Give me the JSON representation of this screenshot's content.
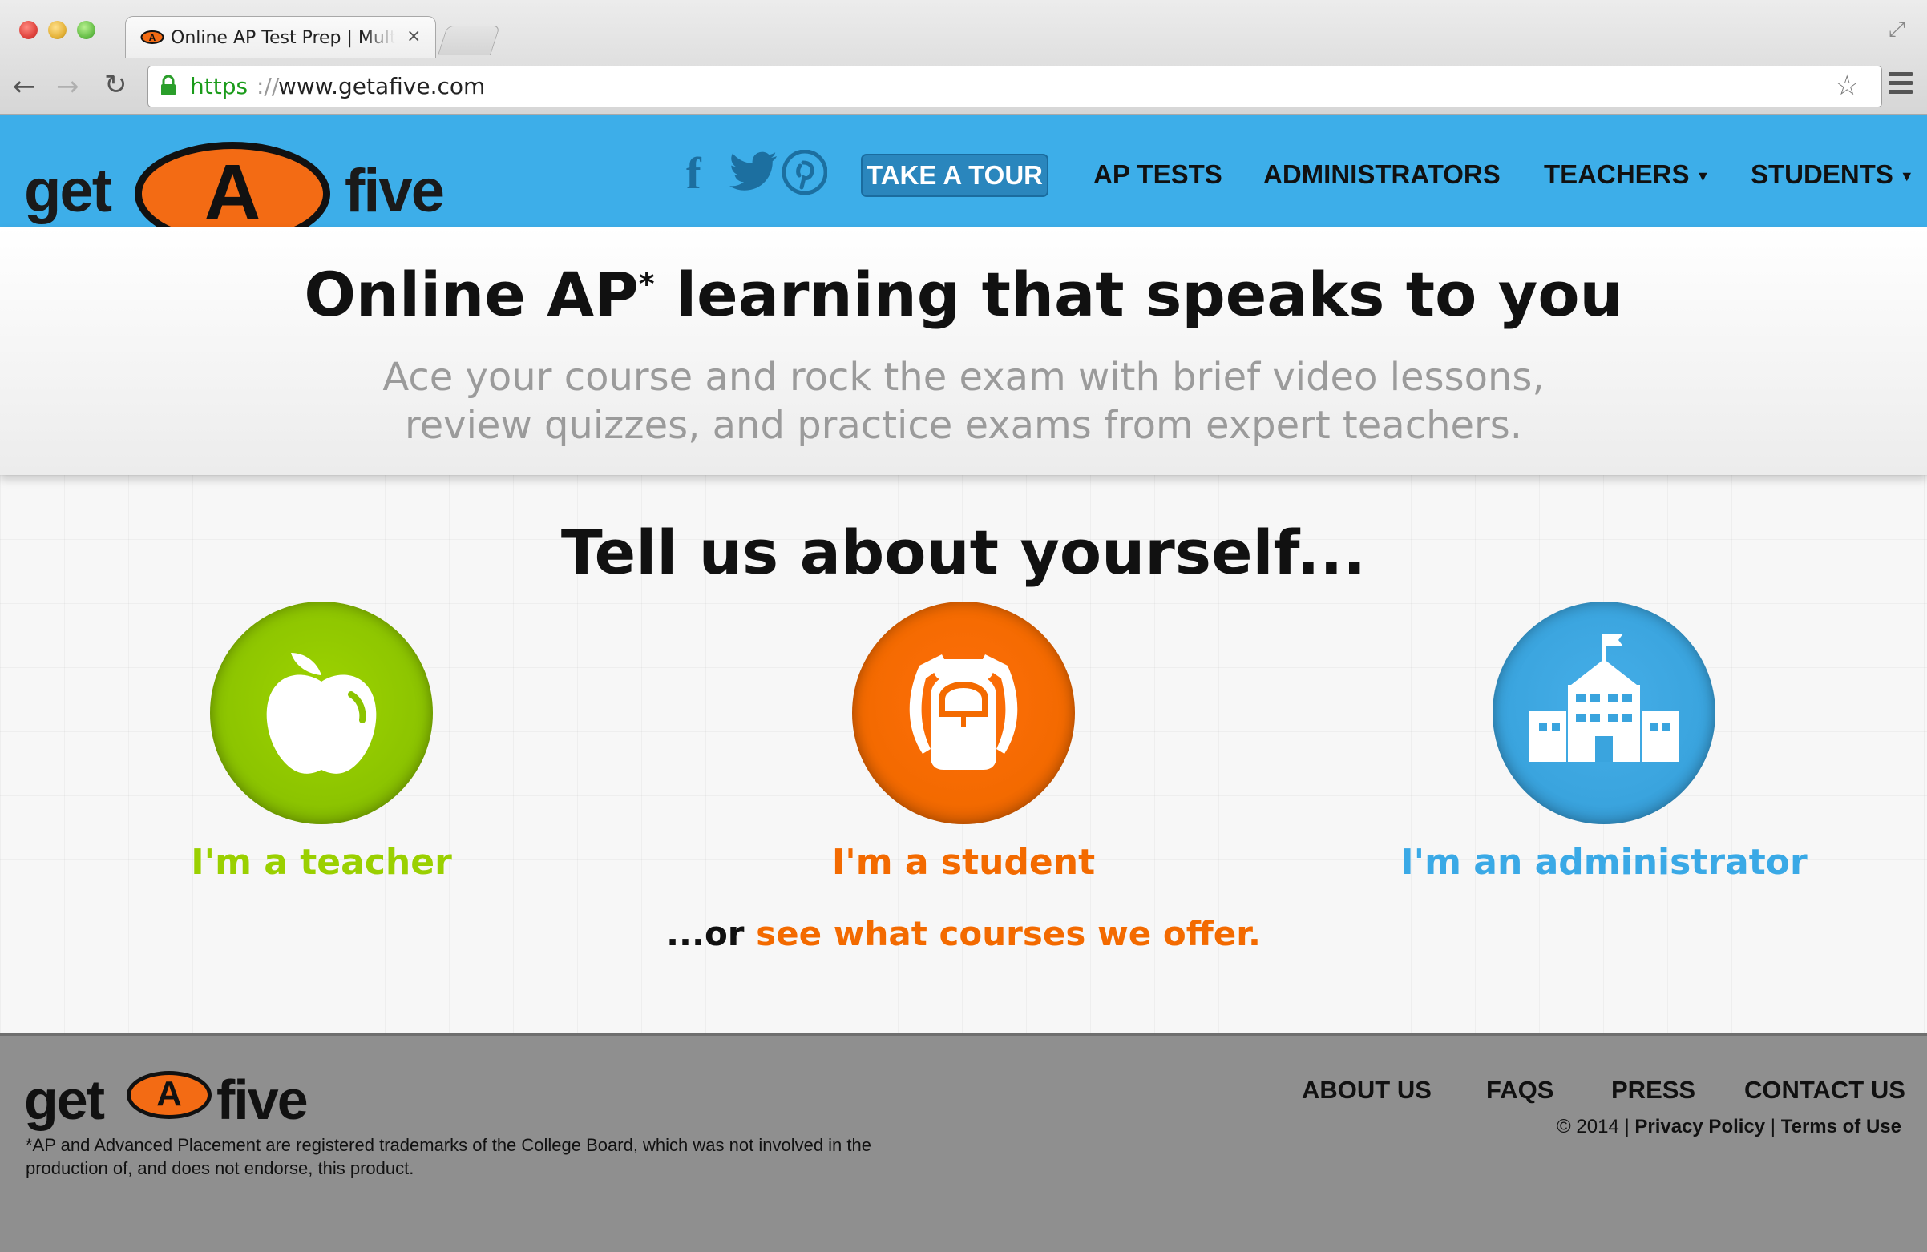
{
  "browser": {
    "tab_title": "Online AP Test Prep | Multi",
    "tab_close": "×",
    "url_scheme": "https",
    "url_separator": "://",
    "url_host": "www.getafive.com",
    "icons": [
      "back-arrow-icon",
      "forward-arrow-icon",
      "reload-icon",
      "lock-icon",
      "star-icon",
      "menu-icon",
      "fullscreen-icon"
    ]
  },
  "header": {
    "logo": {
      "get": "get",
      "a": "A",
      "five": "five"
    },
    "social": [
      "facebook-icon",
      "twitter-icon",
      "pinterest-icon"
    ],
    "nav": {
      "tour": "TAKE A TOUR",
      "ap_tests": "AP TESTS",
      "administrators": "ADMINISTRATORS",
      "teachers": "TEACHERS",
      "students": "STUDENTS"
    },
    "colors": {
      "bar": "#3daee9",
      "tour_button": "#2a86bd",
      "logo_orange": "#f36b14"
    }
  },
  "hero": {
    "title_before": "Online AP",
    "title_sup": "*",
    "title_after": " learning that speaks to you",
    "subtitle": "Ace your course and rock the exam with brief video lessons, review quizzes, and practice exams from expert teachers."
  },
  "main": {
    "title": "Tell us about yourself...",
    "choices": [
      {
        "label": "I'm a teacher",
        "icon": "apple-icon",
        "color": "#8cc400"
      },
      {
        "label": "I'm a student",
        "icon": "backpack-icon",
        "color": "#f36a00"
      },
      {
        "label": "I'm an administrator",
        "icon": "school-building-icon",
        "color": "#3aa4de"
      }
    ],
    "offer_prefix": "...or ",
    "offer_link": "see what courses we offer."
  },
  "footer": {
    "logo": {
      "get": "get",
      "a": "A",
      "five": "five"
    },
    "disclaimer": "*AP and Advanced Placement are registered trademarks of the College Board, which was not involved in the production of, and does not endorse, this product.",
    "links": {
      "about": "ABOUT US",
      "faqs": "FAQS",
      "press": "PRESS",
      "contact": "CONTACT US"
    },
    "copyright": "© 2014 | ",
    "privacy": "Privacy Policy",
    "divider": " | ",
    "terms": "Terms of Use"
  }
}
